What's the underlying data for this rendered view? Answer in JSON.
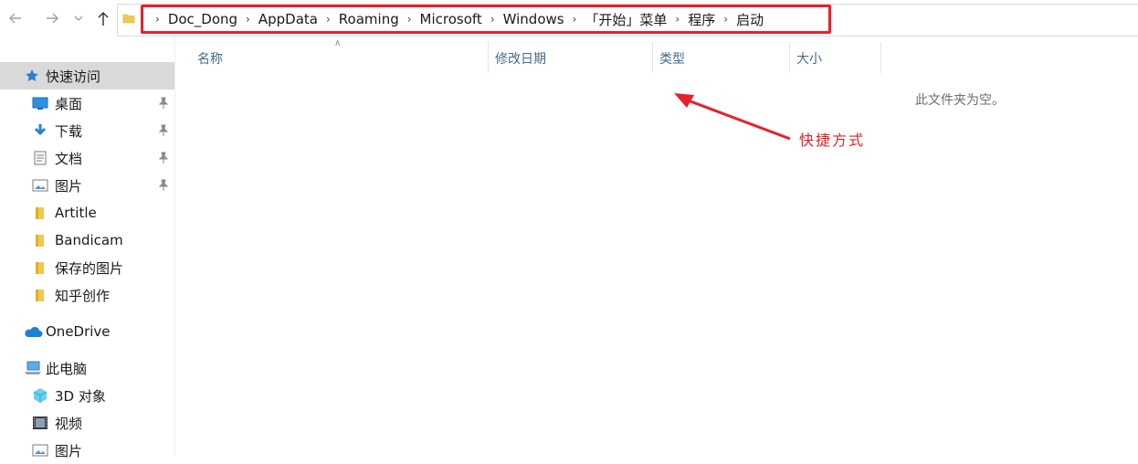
{
  "nav": {
    "back_icon": "arrow-left-icon",
    "forward_icon": "arrow-right-icon",
    "history_icon": "chevron-down-icon",
    "up_icon": "arrow-up-icon"
  },
  "address": {
    "crumbs": [
      "Doc_Dong",
      "AppData",
      "Roaming",
      "Microsoft",
      "Windows",
      "「开始」菜单",
      "程序",
      "启动"
    ],
    "highlight_color": "#e8202a"
  },
  "sidebar": {
    "items": [
      {
        "label": "快速访问",
        "icon": "star-icon"
      },
      {
        "label": "桌面",
        "icon": "desktop-icon"
      },
      {
        "label": "下载",
        "icon": "download-icon"
      },
      {
        "label": "文档",
        "icon": "document-icon"
      },
      {
        "label": "图片",
        "icon": "pictures-icon"
      },
      {
        "label": "Artitle",
        "icon": "folder-icon"
      },
      {
        "label": "Bandicam",
        "icon": "folder-icon"
      },
      {
        "label": "保存的图片",
        "icon": "folder-icon"
      },
      {
        "label": "知乎创作",
        "icon": "folder-icon"
      },
      {
        "label": "OneDrive",
        "icon": "cloud-icon"
      },
      {
        "label": "此电脑",
        "icon": "computer-icon"
      },
      {
        "label": "3D 对象",
        "icon": "cube-icon"
      },
      {
        "label": "视频",
        "icon": "video-icon"
      },
      {
        "label": "图片",
        "icon": "pictures-icon"
      }
    ]
  },
  "columns": [
    "名称",
    "修改日期",
    "类型",
    "大小"
  ],
  "empty_message": "此文件夹为空。",
  "annotation": {
    "text": "快捷方式",
    "color": "#e8202a"
  }
}
